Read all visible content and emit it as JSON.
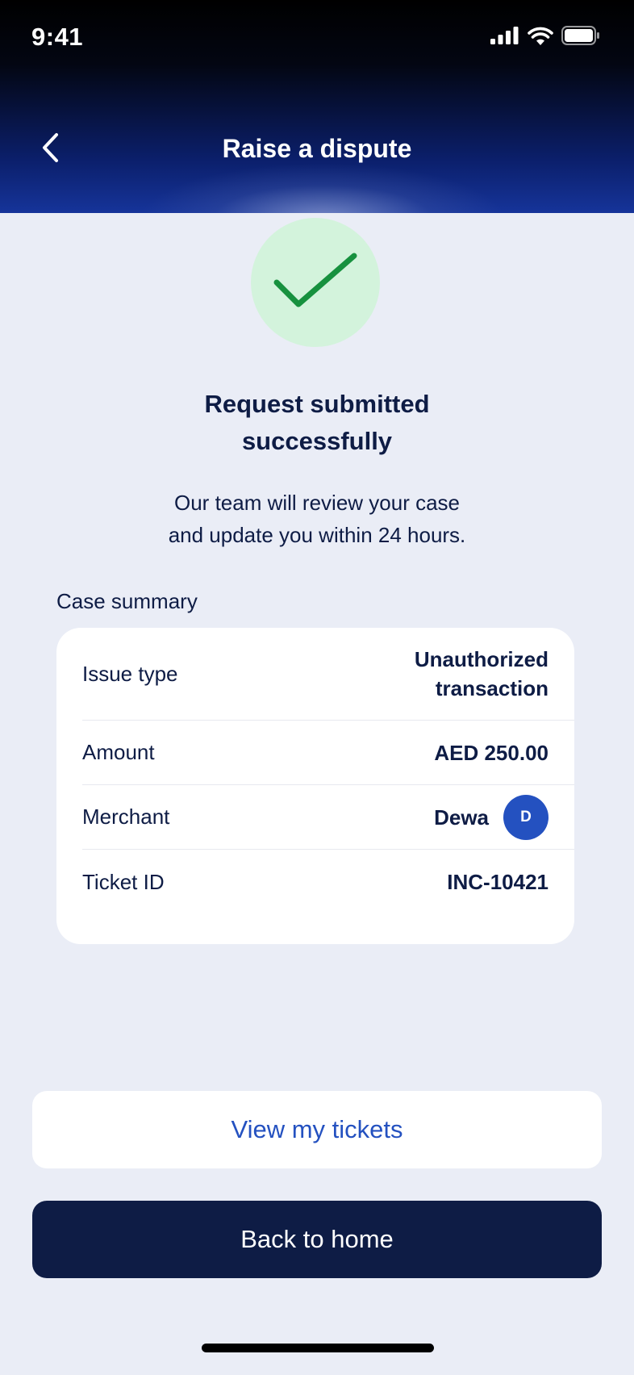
{
  "status_bar": {
    "time": "9:41"
  },
  "header": {
    "title": "Raise a dispute",
    "back_icon": "chevron-left-icon"
  },
  "success": {
    "icon": "checkmark-icon",
    "title_line1": "Request submitted",
    "title_line2": "successfully",
    "desc_line1": "Our team will review your case",
    "desc_line2": "and update you within 24 hours."
  },
  "case_summary": {
    "label": "Case summary",
    "rows": [
      {
        "label": "Issue type",
        "value_line1": "Unauthorized",
        "value_line2": "transaction"
      },
      {
        "label": "Amount",
        "value": "AED 250.00"
      },
      {
        "label": "Merchant",
        "value": "Dewa",
        "avatar_initial": "D"
      },
      {
        "label": "Ticket ID",
        "value": "INC-10421"
      }
    ]
  },
  "actions": {
    "view_tickets": "View my tickets",
    "back_home": "Back to home"
  },
  "colors": {
    "navy": "#0e1c45",
    "accent_blue": "#2451c0",
    "success_green": "#17913f",
    "success_bg": "#d3f3dc",
    "page_bg": "#eaedf6"
  }
}
